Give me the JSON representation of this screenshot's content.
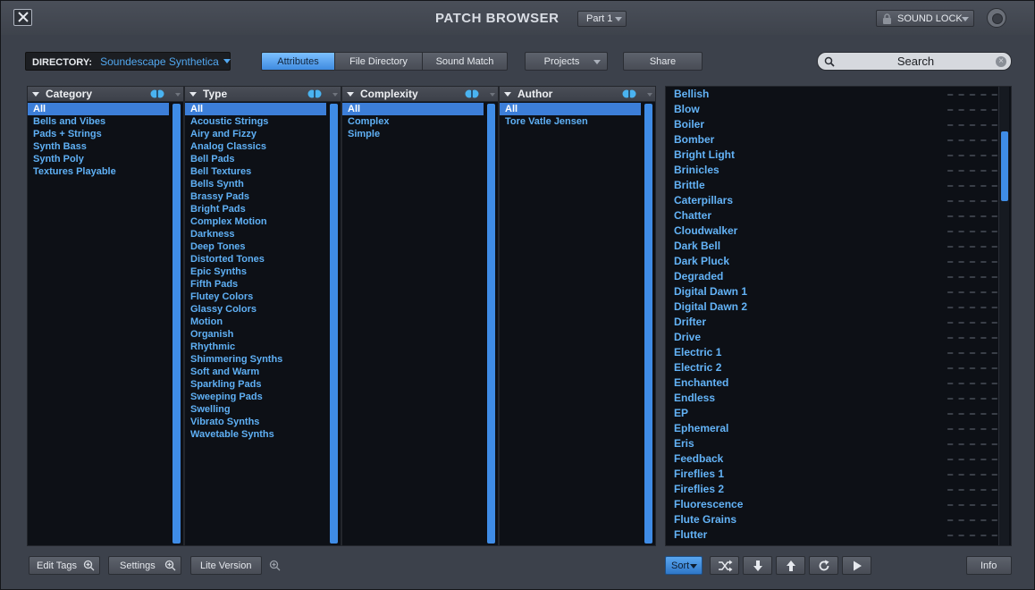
{
  "window": {
    "title": "PATCH BROWSER",
    "part": "Part 1",
    "sound_lock": "SOUND LOCK"
  },
  "toolbar": {
    "directory_label": "DIRECTORY:",
    "directory_value": "Soundescape Synthetica",
    "tabs": [
      {
        "label": "Attributes",
        "active": true
      },
      {
        "label": "File Directory",
        "active": false
      },
      {
        "label": "Sound Match",
        "active": false
      }
    ],
    "projects_label": "Projects",
    "share_label": "Share",
    "search_placeholder": "Search"
  },
  "columns": {
    "category": {
      "name": "Category",
      "items": [
        "All",
        "Bells and Vibes",
        "Pads + Strings",
        "Synth Bass",
        "Synth Poly",
        "Textures Playable"
      ]
    },
    "type": {
      "name": "Type",
      "items": [
        "All",
        "Acoustic Strings",
        "Airy and Fizzy",
        "Analog Classics",
        "Bell Pads",
        "Bell Textures",
        "Bells Synth",
        "Brassy Pads",
        "Bright Pads",
        "Complex Motion",
        "Darkness",
        "Deep Tones",
        "Distorted Tones",
        "Epic Synths",
        "Fifth Pads",
        "Flutey Colors",
        "Glassy Colors",
        "Motion",
        "Organish",
        "Rhythmic",
        "Shimmering Synths",
        "Soft and Warm",
        "Sparkling Pads",
        "Sweeping Pads",
        "Swelling",
        "Vibrato Synths",
        "Wavetable Synths"
      ]
    },
    "complexity": {
      "name": "Complexity",
      "items": [
        "All",
        "Complex",
        "Simple"
      ]
    },
    "author": {
      "name": "Author",
      "items": [
        "All",
        "Tore Vatle Jensen"
      ]
    }
  },
  "results": [
    "Bellish",
    "Blow",
    "Boiler",
    "Bomber",
    "Bright Light",
    "Brinicles",
    "Brittle",
    "Caterpillars",
    "Chatter",
    "Cloudwalker",
    "Dark Bell",
    "Dark Pluck",
    "Degraded",
    "Digital Dawn 1",
    "Digital Dawn 2",
    "Drifter",
    "Drive",
    "Electric 1",
    "Electric 2",
    "Enchanted",
    "Endless",
    "EP",
    "Ephemeral",
    "Eris",
    "Feedback",
    "Fireflies 1",
    "Fireflies 2",
    "Fluorescence",
    "Flute Grains",
    "Flutter"
  ],
  "bottom": {
    "edit_tags": "Edit Tags",
    "settings": "Settings",
    "lite_version": "Lite Version",
    "sort": "Sort",
    "info": "Info"
  },
  "colors": {
    "accent": "#3f8ce6",
    "list_text": "#5fb0f5",
    "selection": "#3c7ed8"
  }
}
